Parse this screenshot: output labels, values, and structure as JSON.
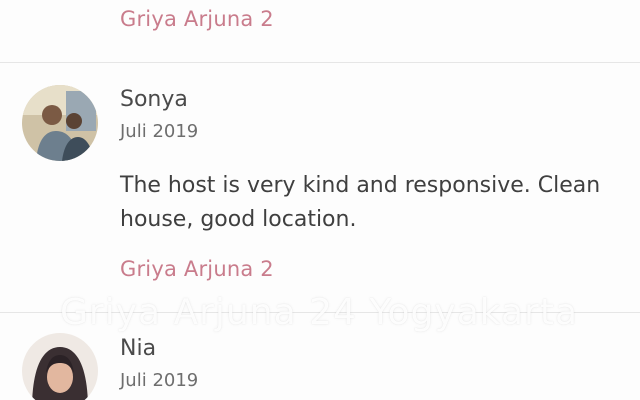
{
  "reviews": [
    {
      "listing": "Griya Arjuna 2"
    },
    {
      "name": "Sonya",
      "date": "Juli 2019",
      "text": "The host is very kind and responsive. Clean house, good location.",
      "listing": "Griya Arjuna 2",
      "avatar_icon": "user-photo-icon"
    },
    {
      "name": "Nia",
      "date": "Juli 2019",
      "avatar_icon": "user-photo-icon"
    }
  ],
  "watermark": "Griya Arjuna 24 Yogyakarta",
  "colors": {
    "link": "#c97c8c",
    "divider": "#e6e6e6",
    "text": "#3f3f3f"
  }
}
